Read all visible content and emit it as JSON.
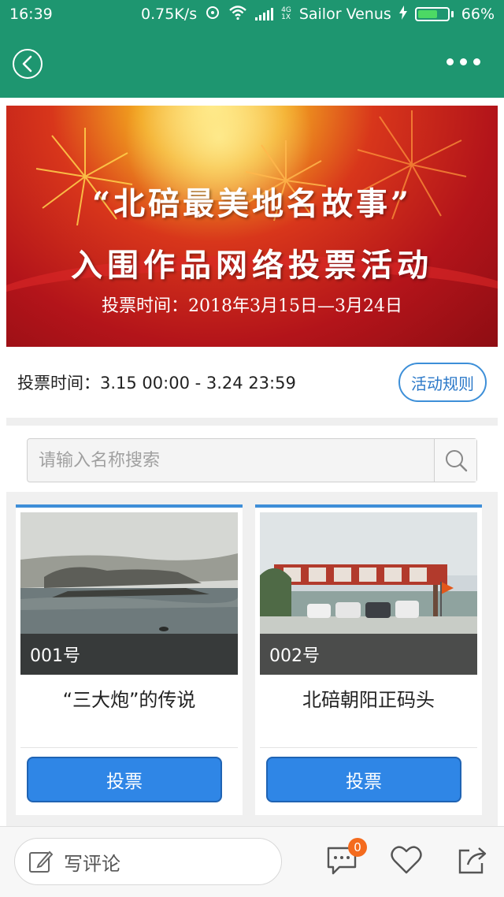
{
  "status_bar": {
    "time": "16:39",
    "speed": "0.75K/s",
    "network": "4G",
    "network_sub": "1X",
    "carrier": "Sailor Venus",
    "battery": "66%",
    "battery_level": 0.66
  },
  "nav": {
    "back_icon": "chevron-left-circle-icon",
    "more_icon": "more-dots-icon"
  },
  "banner": {
    "title_line1": "“北碚最美地名故事”",
    "title_line2": "入围作品网络投票活动",
    "subtitle": "投票时间：2018年3月15日—3月24日"
  },
  "vote_info": {
    "vote_time": "投票时间：3.15 00:00 - 3.24 23:59",
    "rules_button": "活动规则"
  },
  "search": {
    "placeholder": "请输入名称搜索",
    "icon": "search-icon"
  },
  "cards": [
    {
      "number": "001号",
      "title": "“三大炮”的传说",
      "vote_label": "投票"
    },
    {
      "number": "002号",
      "title": "北碚朝阳正码头",
      "vote_label": "投票"
    }
  ],
  "bottom_bar": {
    "comment_placeholder": "写评论",
    "comment_count": "0",
    "icons": [
      "edit-icon",
      "comment-icon",
      "heart-icon",
      "share-icon"
    ]
  },
  "colors": {
    "header_green": "#1e9670",
    "accent_blue": "#2f86e6",
    "badge_orange": "#f46b1e"
  }
}
